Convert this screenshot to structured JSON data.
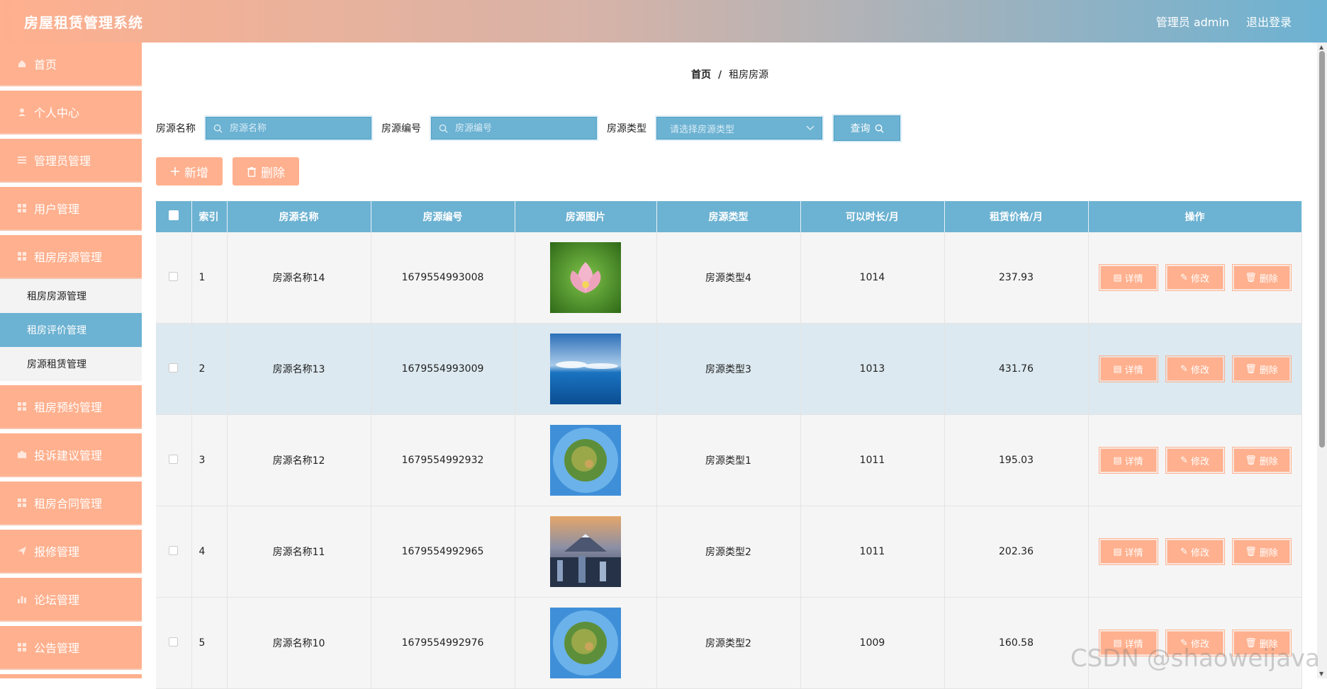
{
  "header": {
    "title": "房屋租赁管理系统",
    "user": "管理员 admin",
    "logout": "退出登录"
  },
  "sidebar": {
    "items": [
      {
        "label": "首页",
        "icon": "home-icon"
      },
      {
        "label": "个人中心",
        "icon": "user-icon"
      },
      {
        "label": "管理员管理",
        "icon": "grid-icon"
      },
      {
        "label": "用户管理",
        "icon": "grid-icon"
      },
      {
        "label": "租房房源管理",
        "icon": "grid-icon"
      },
      {
        "label": "租房预约管理",
        "icon": "grid-icon"
      },
      {
        "label": "投诉建议管理",
        "icon": "grid-icon"
      },
      {
        "label": "租房合同管理",
        "icon": "grid-icon"
      },
      {
        "label": "报修管理",
        "icon": "send-icon"
      },
      {
        "label": "论坛管理",
        "icon": "chart-icon"
      },
      {
        "label": "公告管理",
        "icon": "grid-icon"
      }
    ],
    "submenu": [
      {
        "label": "租房房源管理"
      },
      {
        "label": "租房评价管理"
      },
      {
        "label": "房源租赁管理"
      }
    ]
  },
  "breadcrumb": {
    "home": "首页",
    "sep": "/",
    "current": "租房房源"
  },
  "search": {
    "name_label": "房源名称",
    "name_placeholder": "房源名称",
    "code_label": "房源编号",
    "code_placeholder": "房源编号",
    "type_label": "房源类型",
    "type_placeholder": "请选择房源类型",
    "query_label": "查询"
  },
  "actions": {
    "add_label": "新增",
    "delete_label": "删除"
  },
  "table": {
    "columns": [
      "索引",
      "房源名称",
      "房源编号",
      "房源图片",
      "房源类型",
      "可以时长/月",
      "租赁价格/月",
      "操作"
    ],
    "rows": [
      {
        "index": "1",
        "name": "房源名称14",
        "code": "1679554993008",
        "image": "lotus-photo",
        "type": "房源类型4",
        "duration": "1014",
        "price": "237.93"
      },
      {
        "index": "2",
        "name": "房源名称13",
        "code": "1679554993009",
        "image": "sea-sky-photo",
        "type": "房源类型3",
        "duration": "1013",
        "price": "431.76"
      },
      {
        "index": "3",
        "name": "房源名称12",
        "code": "1679554992932",
        "image": "tiny-planet-photo",
        "type": "房源类型1",
        "duration": "1011",
        "price": "195.03"
      },
      {
        "index": "4",
        "name": "房源名称11",
        "code": "1679554992965",
        "image": "city-mountain-photo",
        "type": "房源类型2",
        "duration": "1011",
        "price": "202.36"
      },
      {
        "index": "5",
        "name": "房源名称10",
        "code": "1679554992976",
        "image": "tiny-planet-photo",
        "type": "房源类型2",
        "duration": "1009",
        "price": "160.58"
      }
    ],
    "op_labels": {
      "detail": "详情",
      "edit": "修改",
      "delete": "删除"
    }
  },
  "watermark": "CSDN @shaoweijava",
  "colors": {
    "accent_orange": "#ffb08e",
    "accent_blue": "#6cb2d2"
  }
}
